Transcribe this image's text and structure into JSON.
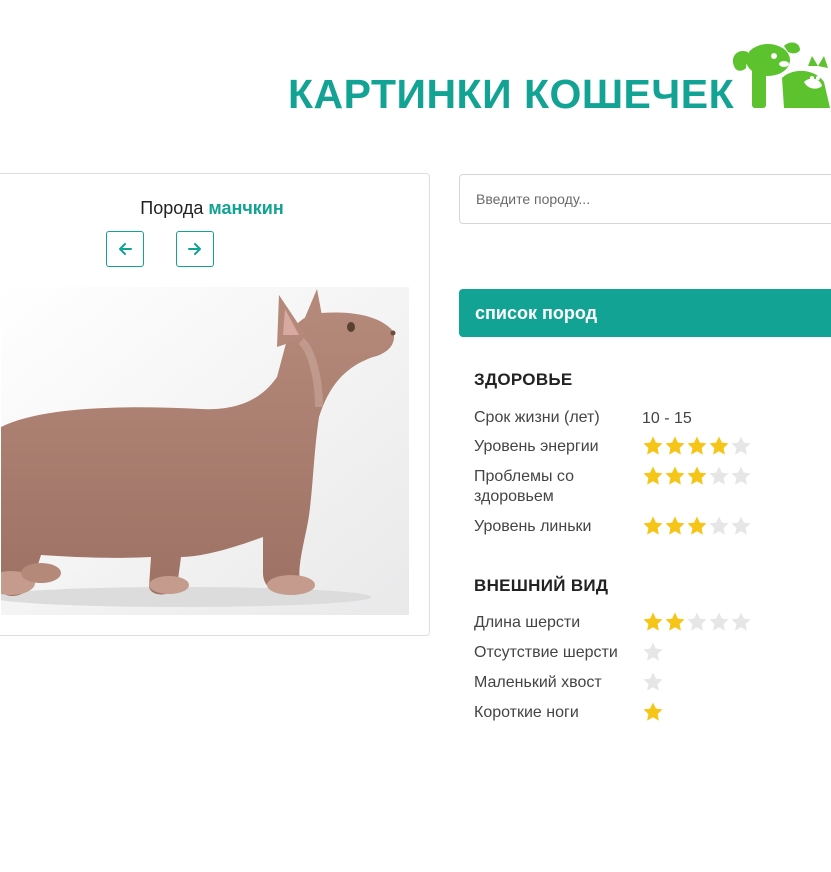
{
  "header": {
    "title": "КАРТИНКИ КОШЕЧЕК",
    "logo_icon": "dog-cat-logo-icon",
    "logo_color": "#5cc22d"
  },
  "card": {
    "prefix": "Порода",
    "breed_name": "манчкин",
    "prev_icon": "arrow-left-icon",
    "next_icon": "arrow-right-icon",
    "photo_icon": "cat-photo"
  },
  "search": {
    "placeholder": "Введите породу..."
  },
  "breed_list_button": "список пород",
  "health": {
    "title": "ЗДОРОВЬЕ",
    "life_label": "Срок жизни (лет)",
    "life_value": "10 - 15",
    "items": [
      {
        "label": "Уровень энергии",
        "rating": 4,
        "max": 5
      },
      {
        "label": "Проблемы со здоровьем",
        "rating": 3,
        "max": 5
      },
      {
        "label": "Уровень линьки",
        "rating": 3,
        "max": 5
      }
    ]
  },
  "appearance": {
    "title": "ВНЕШНИЙ ВИД",
    "items": [
      {
        "label": "Длина шерсти",
        "rating": 2,
        "max": 5
      },
      {
        "label": "Отсутствие шерсти",
        "rating": 0,
        "max": 1
      },
      {
        "label": "Маленький хвост",
        "rating": 0,
        "max": 1
      },
      {
        "label": "Короткие ноги",
        "rating": 1,
        "max": 1
      }
    ]
  },
  "colors": {
    "accent": "#13a394",
    "star_on": "#f5c518",
    "star_off": "#e6e6e6"
  }
}
